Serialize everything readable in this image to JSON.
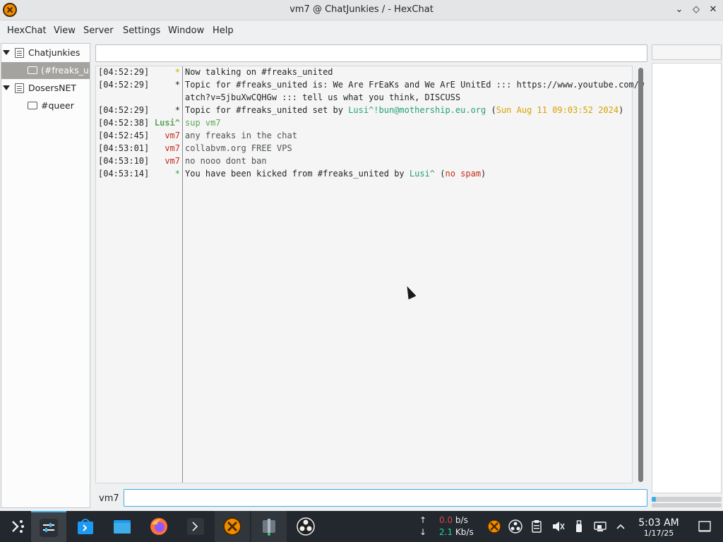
{
  "window": {
    "title": "vm7 @ ChatJunkies / - HexChat",
    "minimize_glyph": "⌄",
    "maximize_glyph": "◇",
    "close_glyph": "✕"
  },
  "menu": {
    "hexchat": "HexChat",
    "view": "View",
    "server": "Server",
    "settings": "Settings",
    "window": "Window",
    "help": "Help"
  },
  "tree": {
    "servers": [
      {
        "name": "Chatjunkies",
        "channels": [
          "(#freaks_united)"
        ]
      },
      {
        "name": "DosersNET",
        "channels": [
          "#queer"
        ]
      }
    ]
  },
  "chat": {
    "lines": [
      {
        "ts": "[04:52:29]",
        "nick": "*",
        "msg": "Now talking on #freaks_united"
      },
      {
        "ts": "[04:52:29]",
        "nick": "*",
        "msg": "Topic for #freaks_united is: We Are FrEaKs and We ArE UnitEd ::: https://www.youtube.com/w",
        "msg2": "atch?v=5jbuXwCQHGw  ::: tell us what you think, DISCUSS"
      },
      {
        "ts": "[04:52:29]",
        "nick": "*",
        "msg_a": "Topic for #freaks_united set by ",
        "msg_b": "Lusi^!bun@mothership.eu.org",
        "msg_c": " (",
        "msg_d": "Sun Aug 11 09:03:52 2024",
        "msg_e": ")"
      },
      {
        "ts": "[04:52:38]",
        "nick": "Lusi^",
        "msg": "sup vm7"
      },
      {
        "ts": "[04:52:45]",
        "nick": "vm7",
        "msg": "any freaks in the chat"
      },
      {
        "ts": "[04:53:01]",
        "nick": "vm7",
        "msg": "collabvm.org FREE VPS"
      },
      {
        "ts": "[04:53:10]",
        "nick": "vm7",
        "msg": "no nooo dont ban"
      },
      {
        "ts": "[04:53:14]",
        "nick": "*",
        "msg_a": "You have been kicked from #freaks_united by ",
        "msg_b": "Lusi^",
        "msg_c": " (",
        "msg_d": "no spam",
        "msg_e": ")"
      }
    ]
  },
  "input": {
    "nick": "vm7",
    "value": ""
  },
  "taskbar": {
    "net_up_value": "0.0",
    "net_up_unit": " b/s",
    "net_down_value": "2.1",
    "net_down_unit": " Kb/s",
    "up_arrow": "↑",
    "down_arrow": "↓",
    "time": "5:03 AM",
    "date": "1/17/25"
  },
  "colors": {
    "accent": "#3daee9",
    "nick_lusi": "#36a853",
    "nick_vm7": "#c42d1b"
  }
}
